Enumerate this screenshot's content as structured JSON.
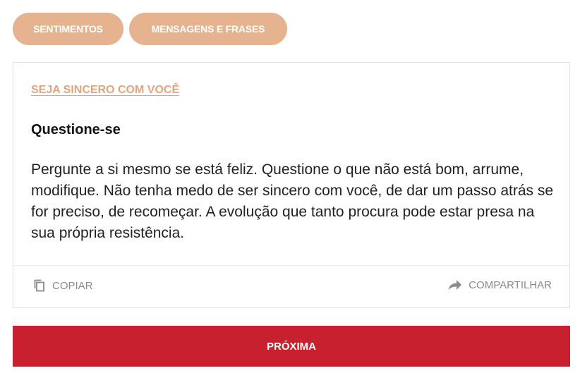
{
  "tags": [
    {
      "label": "SENTIMENTOS"
    },
    {
      "label": "MENSAGENS E FRASES"
    }
  ],
  "card": {
    "category": "SEJA SINCERO COM VOCÊ",
    "title": "Questione-se",
    "text": "Pergunte a si mesmo se está feliz. Questione o que não está bom, arrume, modifique. Não tenha medo de ser sincero com você, de dar um passo atrás se for preciso, de recomeçar. A evolução que tanto procura pode estar presa na sua própria resistência.",
    "actions": {
      "copy_label": "COPIAR",
      "copy_icon": "copy-icon",
      "share_label": "COMPARTILHAR",
      "share_icon": "share-arrow-icon"
    }
  },
  "next_button": {
    "label": "PRÓXIMA"
  },
  "colors": {
    "tag_bg": "#e6b391",
    "category": "#e6a37a",
    "next_bg": "#c8202e",
    "action_text": "#8a8a8a"
  }
}
